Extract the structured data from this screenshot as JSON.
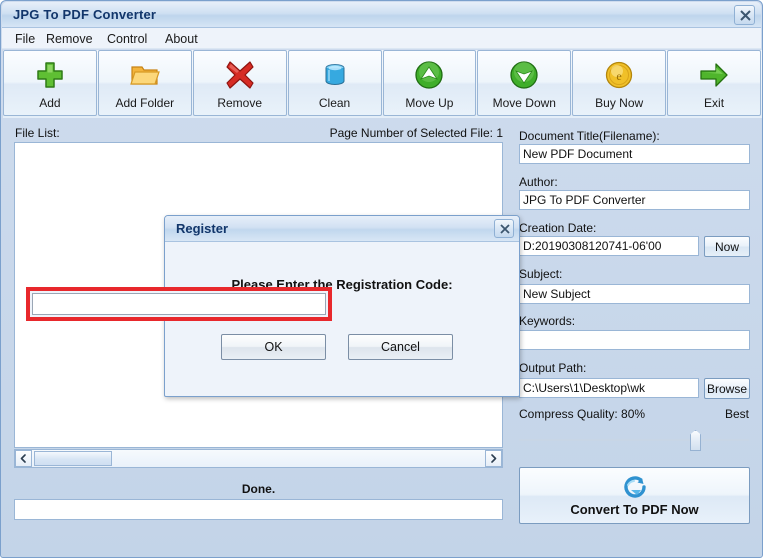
{
  "window": {
    "title": "JPG To PDF Converter",
    "close_icon": "close-icon"
  },
  "menu": {
    "items": [
      {
        "label": "File"
      },
      {
        "label": "Remove"
      },
      {
        "label": "Control"
      },
      {
        "label": "About"
      }
    ]
  },
  "toolbar": {
    "buttons": [
      {
        "label": "Add",
        "icon": "plus-icon"
      },
      {
        "label": "Add Folder",
        "icon": "folder-icon"
      },
      {
        "label": "Remove",
        "icon": "red-x-icon"
      },
      {
        "label": "Clean",
        "icon": "bucket-icon"
      },
      {
        "label": "Move Up",
        "icon": "arrow-up-circle-icon"
      },
      {
        "label": "Move Down",
        "icon": "arrow-down-circle-icon"
      },
      {
        "label": "Buy Now",
        "icon": "coin-icon"
      },
      {
        "label": "Exit",
        "icon": "green-arrow-right-icon"
      }
    ]
  },
  "left_panel": {
    "file_list_label": "File List:",
    "page_number_label": "Page Number of Selected File: 1",
    "file_list_items": [],
    "status_text": "Done.",
    "progress_value": "",
    "scroll_left_icon": "chevron-left-icon",
    "scroll_right_icon": "chevron-right-icon"
  },
  "right_panel": {
    "document_title": {
      "label": "Document Title(Filename):",
      "value": "New PDF Document"
    },
    "author": {
      "label": "Author:",
      "value": "JPG To PDF Converter"
    },
    "creation_date": {
      "label": "Creation Date:",
      "value": "D:20190308120741-06'00",
      "button_label": "Now"
    },
    "subject": {
      "label": "Subject:",
      "value": "New Subject"
    },
    "keywords": {
      "label": "Keywords:",
      "value": ""
    },
    "output_path": {
      "label": "Output Path:",
      "value": "C:\\Users\\1\\Desktop\\wk",
      "button_label": "Browse"
    },
    "compress_quality": {
      "label": "Compress Quality: 80%",
      "max_label": "Best",
      "value": 80
    },
    "convert_button": {
      "label": "Convert To PDF Now",
      "icon": "convert-refresh-icon"
    }
  },
  "dialog": {
    "title": "Register",
    "close_icon": "close-icon",
    "prompt": "Please Enter the Registration Code:",
    "code_value": "",
    "code_placeholder": "",
    "ok_label": "OK",
    "cancel_label": "Cancel",
    "highlight_color": "#e8282c"
  }
}
